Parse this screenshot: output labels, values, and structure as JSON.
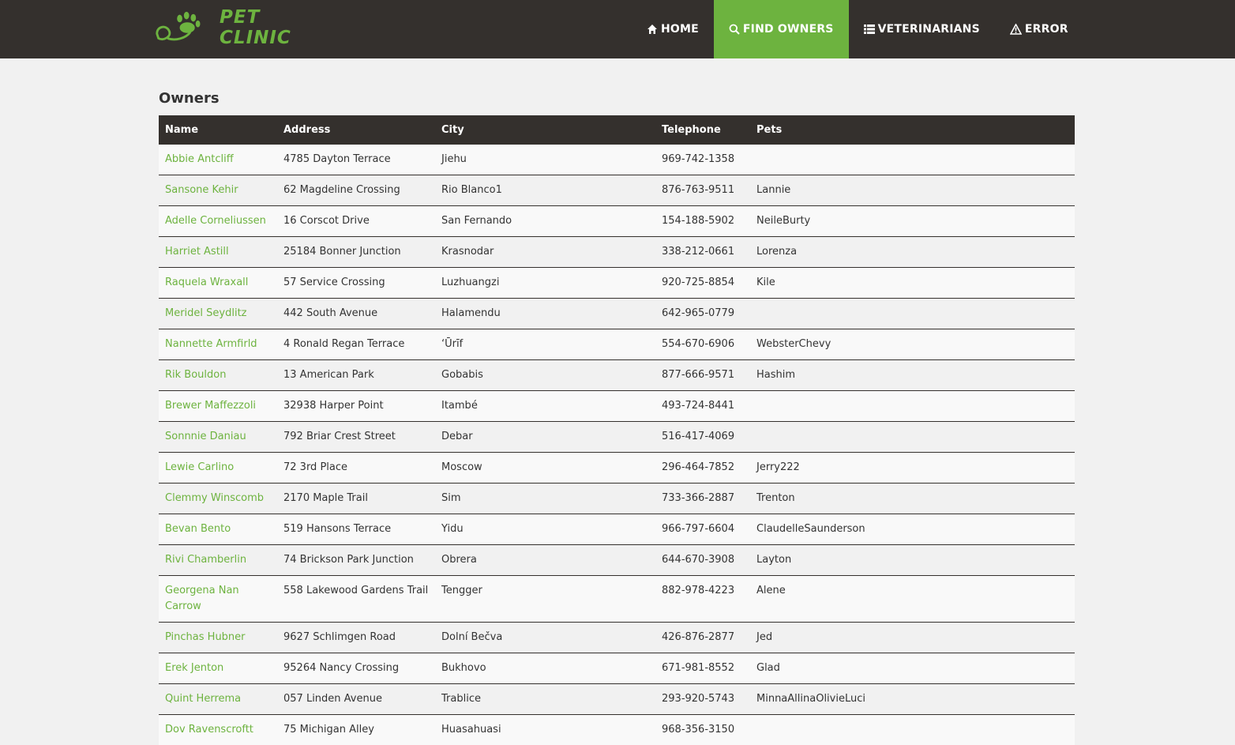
{
  "brand": {
    "name": "PET CLINIC",
    "accent": "#6db33f",
    "nav_bg": "#34302d"
  },
  "nav": [
    {
      "label": "HOME",
      "icon": "home-icon",
      "active": false
    },
    {
      "label": "FIND OWNERS",
      "icon": "search-icon",
      "active": true
    },
    {
      "label": "VETERINARIANS",
      "icon": "list-icon",
      "active": false
    },
    {
      "label": "ERROR",
      "icon": "warning-icon",
      "active": false
    }
  ],
  "page_title": "Owners",
  "table": {
    "headers": [
      "Name",
      "Address",
      "City",
      "Telephone",
      "Pets"
    ],
    "rows": [
      {
        "name": "Abbie Antcliff",
        "address": "4785 Dayton Terrace",
        "city": "Jiehu",
        "telephone": "969-742-1358",
        "pets": ""
      },
      {
        "name": "Sansone Kehir",
        "address": "62 Magdeline Crossing",
        "city": "Rio Blanco1",
        "telephone": "876-763-9511",
        "pets": "Lannie"
      },
      {
        "name": "Adelle Corneliussen",
        "address": "16 Corscot Drive",
        "city": "San Fernando",
        "telephone": "154-188-5902",
        "pets": "NeileBurty"
      },
      {
        "name": "Harriet Astill",
        "address": "25184 Bonner Junction",
        "city": "Krasnodar",
        "telephone": "338-212-0661",
        "pets": "Lorenza"
      },
      {
        "name": "Raquela Wraxall",
        "address": "57 Service Crossing",
        "city": "Luzhuangzi",
        "telephone": "920-725-8854",
        "pets": "Kile"
      },
      {
        "name": "Meridel Seydlitz",
        "address": "442 South Avenue",
        "city": "Halamendu",
        "telephone": "642-965-0779",
        "pets": ""
      },
      {
        "name": "Nannette Armfirld",
        "address": "4 Ronald Regan Terrace",
        "city": "‘Ūrīf",
        "telephone": "554-670-6906",
        "pets": "WebsterChevy"
      },
      {
        "name": "Rik Bouldon",
        "address": "13 American Park",
        "city": "Gobabis",
        "telephone": "877-666-9571",
        "pets": "Hashim"
      },
      {
        "name": "Brewer Maffezzoli",
        "address": "32938 Harper Point",
        "city": "Itambé",
        "telephone": "493-724-8441",
        "pets": ""
      },
      {
        "name": "Sonnnie Daniau",
        "address": "792 Briar Crest Street",
        "city": "Debar",
        "telephone": "516-417-4069",
        "pets": ""
      },
      {
        "name": "Lewie Carlino",
        "address": "72 3rd Place",
        "city": "Moscow",
        "telephone": "296-464-7852",
        "pets": "Jerry222"
      },
      {
        "name": "Clemmy Winscomb",
        "address": "2170 Maple Trail",
        "city": "Sim",
        "telephone": "733-366-2887",
        "pets": "Trenton"
      },
      {
        "name": "Bevan Bento",
        "address": "519 Hansons Terrace",
        "city": "Yidu",
        "telephone": "966-797-6604",
        "pets": "ClaudelleSaunderson"
      },
      {
        "name": "Rivi Chamberlin",
        "address": "74 Brickson Park Junction",
        "city": "Obrera",
        "telephone": "644-670-3908",
        "pets": "Layton"
      },
      {
        "name": "Georgena Nan Carrow",
        "address": "558 Lakewood Gardens Trail",
        "city": "Tengger",
        "telephone": "882-978-4223",
        "pets": "Alene"
      },
      {
        "name": "Pinchas Hubner",
        "address": "9627 Schlimgen Road",
        "city": "Dolní Bečva",
        "telephone": "426-876-2877",
        "pets": "Jed"
      },
      {
        "name": "Erek Jenton",
        "address": "95264 Nancy Crossing",
        "city": "Bukhovo",
        "telephone": "671-981-8552",
        "pets": "Glad"
      },
      {
        "name": "Quint Herrema",
        "address": "057 Linden Avenue",
        "city": "Trablice",
        "telephone": "293-920-5743",
        "pets": "MinnaAllinaOlivieLuci"
      },
      {
        "name": "Dov Ravenscroftt",
        "address": "75 Michigan Alley",
        "city": "Huasahuasi",
        "telephone": "968-356-3150",
        "pets": ""
      }
    ]
  }
}
